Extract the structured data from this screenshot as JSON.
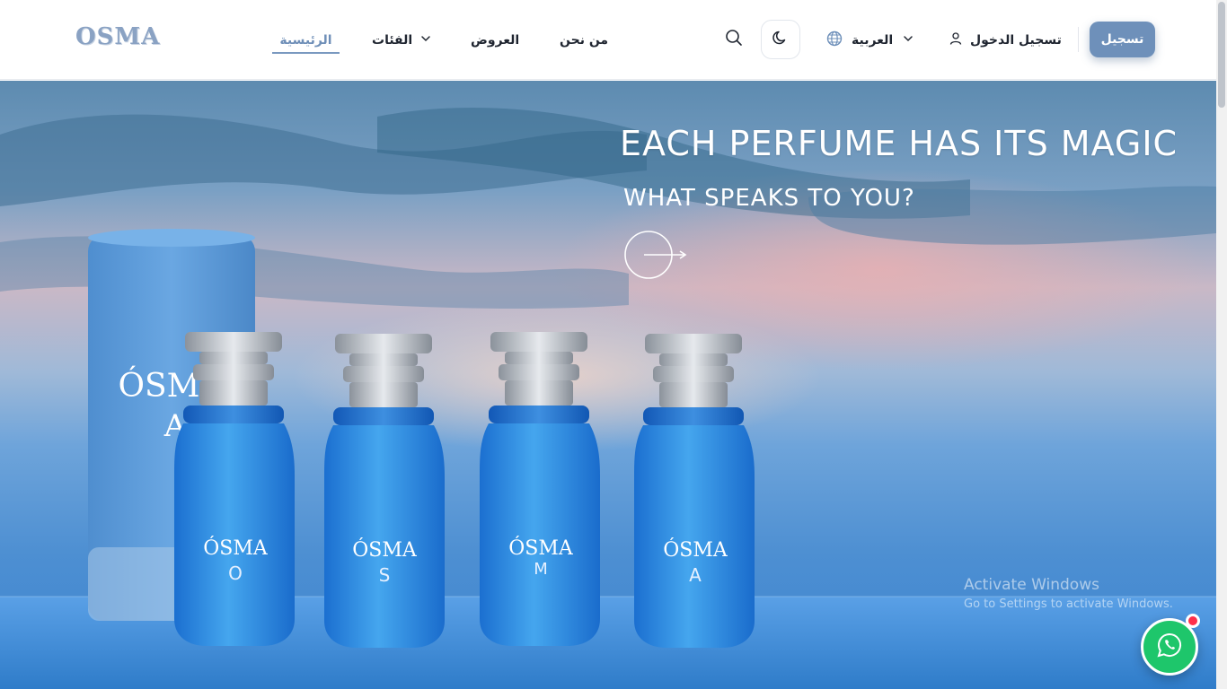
{
  "header": {
    "logo": "OSMA",
    "nav": {
      "home": "الرئيسية",
      "categories": "الفئات",
      "offers": "العروض",
      "about": "من نحن"
    },
    "language": "العربية",
    "login": "تسجيل الدخول",
    "register": "تسجيل"
  },
  "hero": {
    "title": "EACH PERFUME HAS ITS MAGIC",
    "subtitle": "WHAT SPEAKS TO YOU?",
    "box_brand": "ÓSMA",
    "box_letter": "A",
    "bottles": [
      {
        "brand": "ÓSMA",
        "letter": "O"
      },
      {
        "brand": "ÓSMA",
        "letter": "S"
      },
      {
        "brand": "ÓSMA",
        "letter": "M"
      },
      {
        "brand": "ÓSMA",
        "letter": "A"
      }
    ]
  },
  "watermark": {
    "title": "Activate Windows",
    "subtitle": "Go to Settings to activate Windows."
  },
  "icons": [
    "search-icon",
    "moon-icon",
    "globe-icon",
    "chevron-down-icon",
    "user-icon",
    "arrow-right-icon",
    "whatsapp-icon"
  ],
  "colors": {
    "accent": "#6e90ba",
    "home_active": "#6f8fb8",
    "whatsapp": "#1ec66b",
    "notification": "#ff2f4a"
  }
}
